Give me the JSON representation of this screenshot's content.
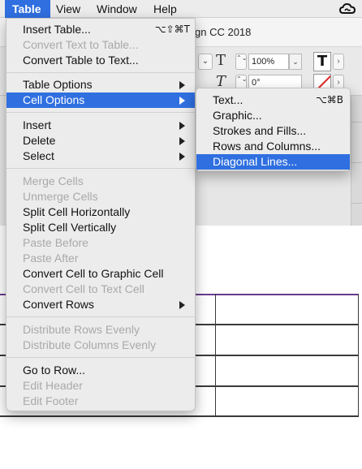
{
  "menubar": {
    "table": "Table",
    "view": "View",
    "window": "Window",
    "help": "Help",
    "status_icon": "creative-cloud-icon"
  },
  "background": {
    "title_fragment": "gn CC 2018",
    "zoom_value": "100%",
    "angle_value": "0°",
    "dropdown_glyph": "⌄",
    "spin_glyph": "⌃⌄",
    "field_dropdown_glyph": "⌄",
    "glyph_t_scale": "T",
    "glyph_t_italic": "T",
    "bold_t": "T",
    "arrow": "›"
  },
  "table_menu": {
    "items": [
      {
        "label": "Insert Table...",
        "shortcut": "⌥⇧⌘T",
        "enabled": true
      },
      {
        "label": "Convert Text to Table...",
        "enabled": false
      },
      {
        "label": "Convert Table to Text...",
        "enabled": true
      },
      {
        "label": "Table Options",
        "submenu": true,
        "enabled": true
      },
      {
        "label": "Cell Options",
        "submenu": true,
        "enabled": true,
        "highlighted": true
      },
      {
        "label": "Insert",
        "submenu": true,
        "enabled": true
      },
      {
        "label": "Delete",
        "submenu": true,
        "enabled": true
      },
      {
        "label": "Select",
        "submenu": true,
        "enabled": true
      },
      {
        "label": "Merge Cells",
        "enabled": false
      },
      {
        "label": "Unmerge Cells",
        "enabled": false
      },
      {
        "label": "Split Cell Horizontally",
        "enabled": true
      },
      {
        "label": "Split Cell Vertically",
        "enabled": true
      },
      {
        "label": "Paste Before",
        "enabled": false
      },
      {
        "label": "Paste After",
        "enabled": false
      },
      {
        "label": "Convert Cell to Graphic Cell",
        "enabled": true
      },
      {
        "label": "Convert Cell to Text Cell",
        "enabled": false
      },
      {
        "label": "Convert Rows",
        "submenu": true,
        "enabled": true
      },
      {
        "label": "Distribute Rows Evenly",
        "enabled": false
      },
      {
        "label": "Distribute Columns Evenly",
        "enabled": false
      },
      {
        "label": "Go to Row...",
        "enabled": true
      },
      {
        "label": "Edit Header",
        "enabled": false
      },
      {
        "label": "Edit Footer",
        "enabled": false
      }
    ]
  },
  "cell_options_submenu": {
    "items": [
      {
        "label": "Text...",
        "shortcut": "⌥⌘B"
      },
      {
        "label": "Graphic..."
      },
      {
        "label": "Strokes and Fills..."
      },
      {
        "label": "Rows and Columns..."
      },
      {
        "label": "Diagonal Lines...",
        "highlighted": true
      }
    ]
  },
  "colors": {
    "highlight": "#2f6fe0",
    "menu_bg": "#ececec",
    "disabled_text": "#a9a9a9",
    "table_top_border": "#6a3b8f"
  }
}
